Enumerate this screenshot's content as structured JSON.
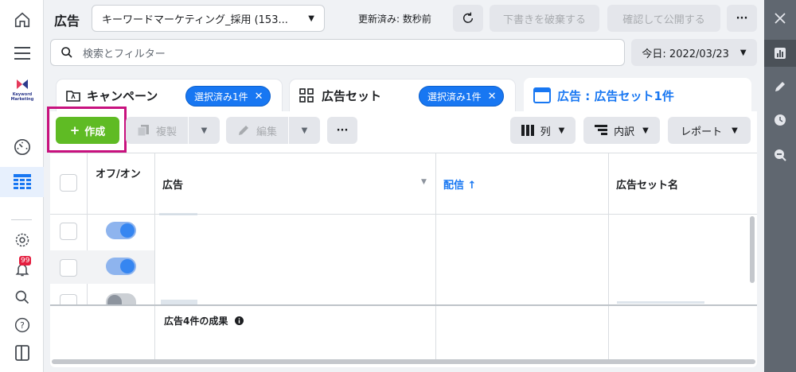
{
  "header": {
    "title": "広告",
    "account": "キーワードマーケティング_採用 (153...",
    "updated": "更新済み: 数秒前",
    "discard": "下書きを破棄する",
    "publish": "確認して公開する",
    "more": "···"
  },
  "search": {
    "placeholder": "検索とフィルター"
  },
  "date": "今日: 2022/03/23",
  "logo": {
    "line1": "Keyword",
    "line2": "Marketing"
  },
  "notifications": {
    "count": "99"
  },
  "tabs": [
    {
      "label": "キャンペーン",
      "chip": "選択済み1件"
    },
    {
      "label": "広告セット",
      "chip": "選択済み1件"
    },
    {
      "label": "広告 : 広告セット1件"
    }
  ],
  "toolbar": {
    "create": "作成",
    "duplicate": "複製",
    "edit": "編集",
    "more": "···",
    "columns": "列",
    "breakdown": "内訳",
    "reports": "レポート"
  },
  "table": {
    "headers": {
      "onoff": "オフ/オン",
      "ad": "広告",
      "delivery": "配信 ↑",
      "adset": "広告セット名"
    },
    "rows": [
      {
        "status": "on"
      },
      {
        "status": "on"
      },
      {
        "status": "off"
      }
    ],
    "summary": "広告4件の成果"
  },
  "colors": {
    "accent": "#1877f2",
    "create": "#5fbb24",
    "highlight": "#c8127e"
  }
}
